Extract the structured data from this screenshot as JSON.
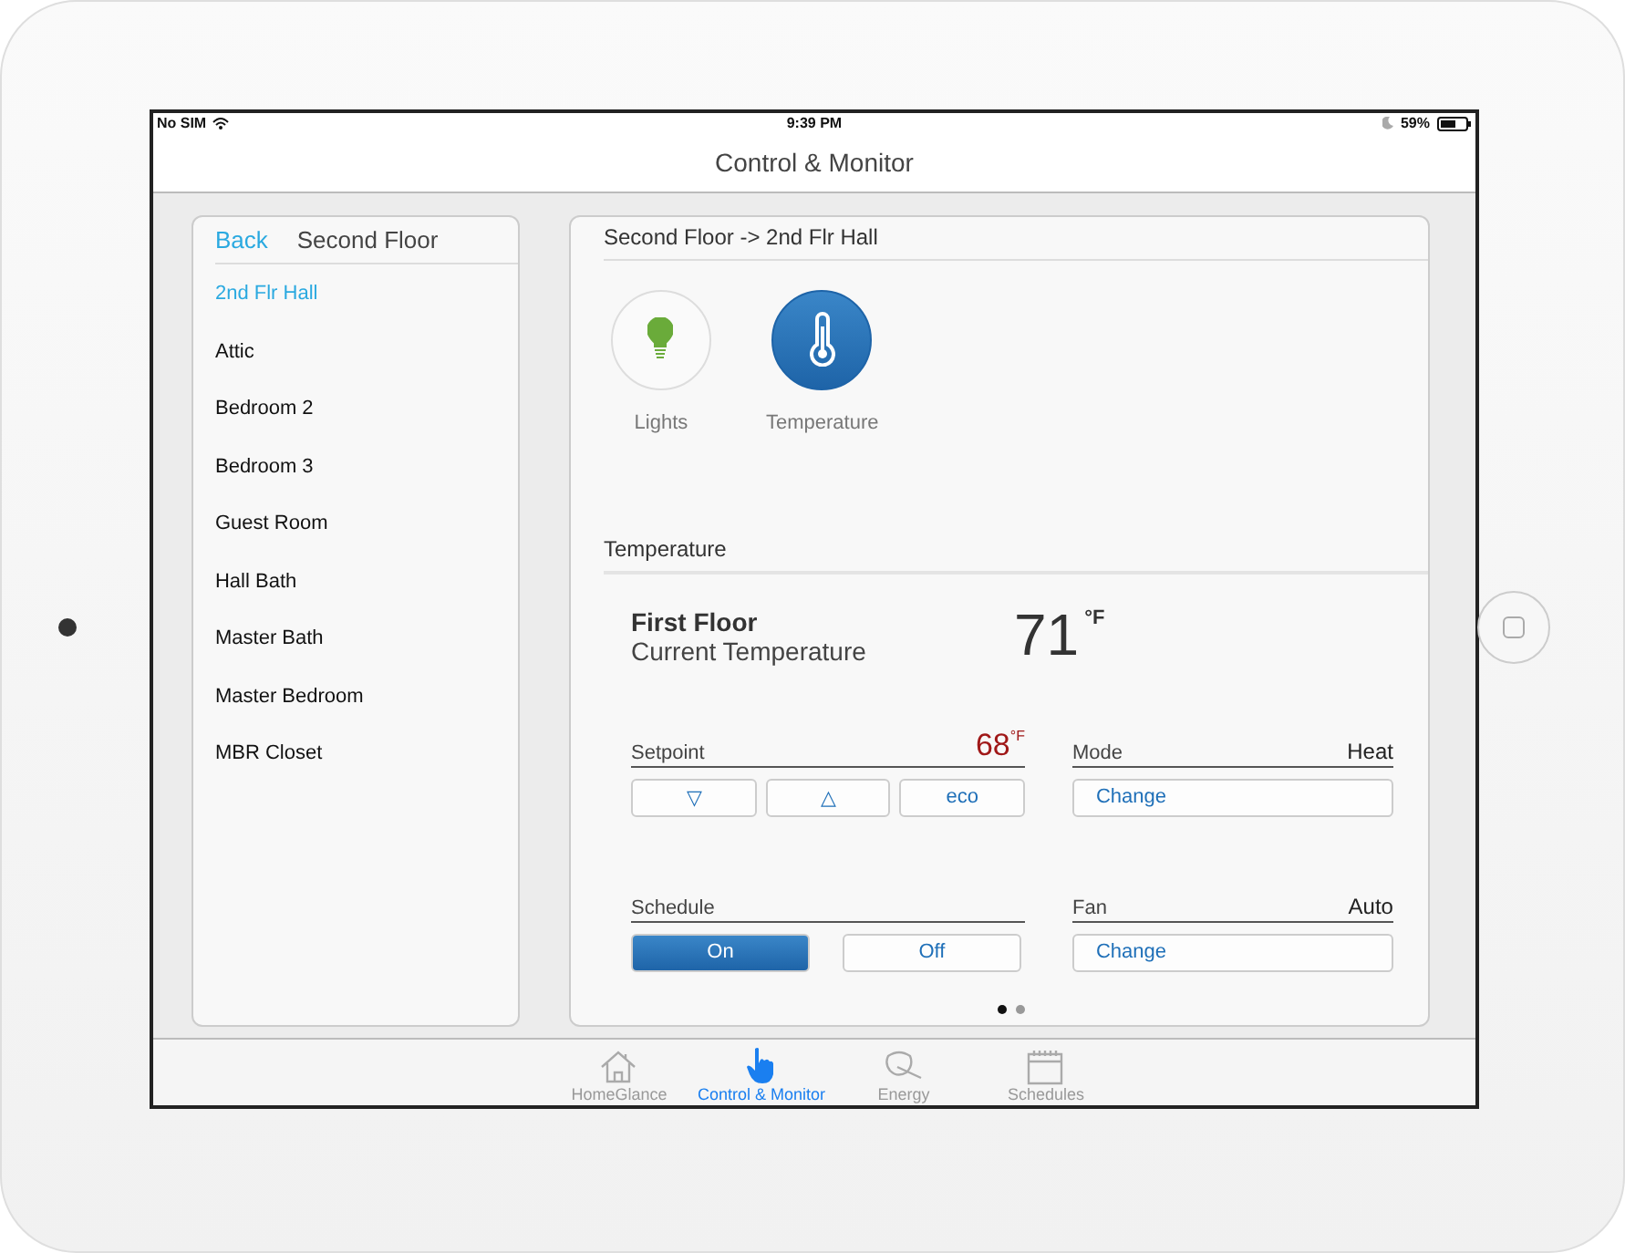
{
  "status_bar": {
    "carrier": "No SIM",
    "time": "9:39 PM",
    "battery": "59%"
  },
  "nav_title": "Control & Monitor",
  "sidebar": {
    "back": "Back",
    "title": "Second Floor",
    "items": [
      {
        "label": "2nd Flr Hall",
        "selected": true
      },
      {
        "label": "Attic",
        "selected": false
      },
      {
        "label": "Bedroom 2",
        "selected": false
      },
      {
        "label": "Bedroom 3",
        "selected": false
      },
      {
        "label": "Guest Room",
        "selected": false
      },
      {
        "label": "Hall Bath",
        "selected": false
      },
      {
        "label": "Master Bath",
        "selected": false
      },
      {
        "label": "Master Bedroom",
        "selected": false
      },
      {
        "label": "MBR Closet",
        "selected": false
      }
    ]
  },
  "detail": {
    "breadcrumb": "Second Floor -> 2nd Flr Hall",
    "devices": [
      {
        "label": "Lights",
        "selected": false
      },
      {
        "label": "Temperature",
        "selected": true
      }
    ],
    "section_title": "Temperature",
    "zone": "First Floor",
    "current_label": "Current Temperature",
    "current_value": "71",
    "current_unit": "°F",
    "setpoint": {
      "label": "Setpoint",
      "value": "68",
      "unit": "°F",
      "buttons": [
        "▽",
        "△",
        "eco"
      ]
    },
    "mode": {
      "label": "Mode",
      "value": "Heat",
      "button": "Change"
    },
    "schedule": {
      "label": "Schedule",
      "options": [
        {
          "label": "On",
          "selected": true
        },
        {
          "label": "Off",
          "selected": false
        }
      ]
    },
    "fan": {
      "label": "Fan",
      "value": "Auto",
      "button": "Change"
    },
    "pages": [
      {
        "selected": true
      },
      {
        "selected": false
      }
    ]
  },
  "tabs": [
    {
      "label": "HomeGlance",
      "selected": false
    },
    {
      "label": "Control & Monitor",
      "selected": true
    },
    {
      "label": "Energy",
      "selected": false
    },
    {
      "label": "Schedules",
      "selected": false
    }
  ]
}
